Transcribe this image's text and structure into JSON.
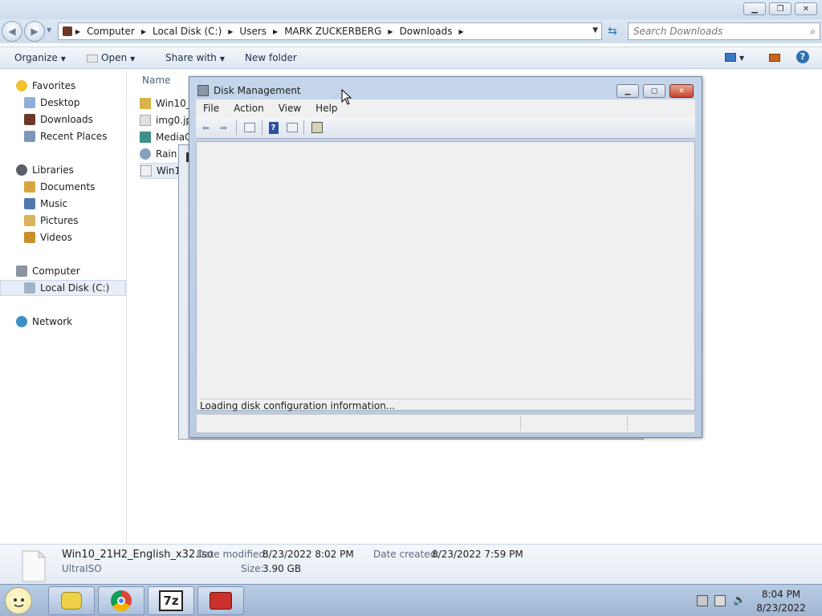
{
  "explorer": {
    "breadcrumb": [
      "Computer",
      "Local Disk (C:)",
      "Users",
      "MARK ZUCKERBERG",
      "Downloads"
    ],
    "search_placeholder": "Search Downloads",
    "toolbar": {
      "organize": "Organize",
      "open": "Open",
      "share_with": "Share with",
      "new_folder": "New folder"
    },
    "nav": {
      "favorites": "Favorites",
      "desktop": "Desktop",
      "downloads": "Downloads",
      "recent_places": "Recent Places",
      "libraries": "Libraries",
      "documents": "Documents",
      "music": "Music",
      "pictures": "Pictures",
      "videos": "Videos",
      "computer": "Computer",
      "local_disk": "Local Disk (C:)",
      "network": "Network"
    },
    "filelist": {
      "column_name": "Name",
      "files": [
        "Win10_",
        "img0.jp",
        "MediaC",
        "Rain",
        "Win1"
      ]
    },
    "details": {
      "filename": "Win10_21H2_English_x32.iso",
      "type": "UltraISO",
      "date_modified_label": "Date modified:",
      "date_modified": "8/23/2022 8:02 PM",
      "size_label": "Size:",
      "size": "3.90 GB",
      "date_created_label": "Date created:",
      "date_created": "8/23/2022 7:59 PM"
    }
  },
  "disk_management": {
    "title": "Disk Management",
    "menu": [
      "File",
      "Action",
      "View",
      "Help"
    ],
    "loading_text": "Loading disk configuration information..."
  },
  "taskbar": {
    "time": "8:04 PM",
    "date": "8/23/2022"
  },
  "colors": {
    "accent": "#2f6fb5",
    "close_red": "#c6452b",
    "taskbar": "#a9bfdc"
  }
}
